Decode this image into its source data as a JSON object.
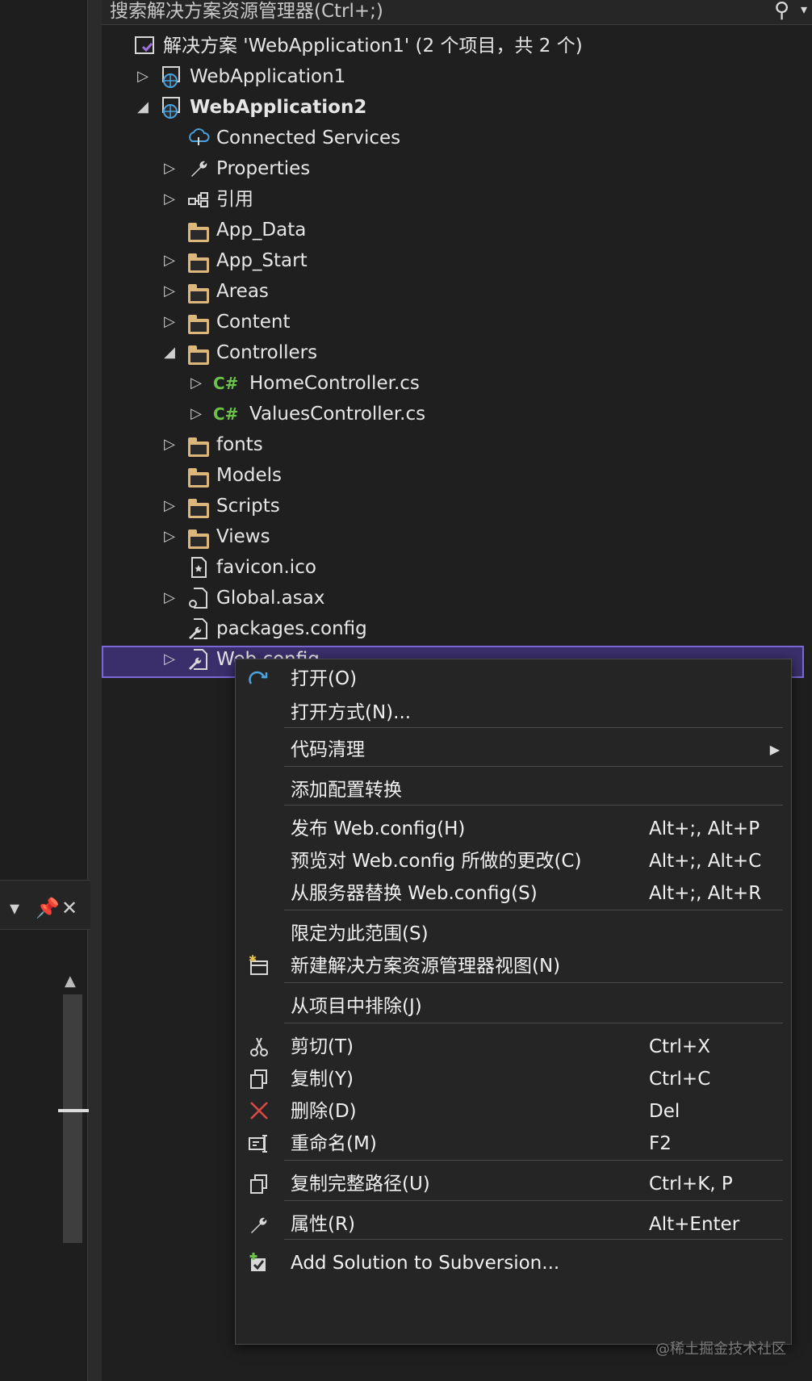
{
  "search": {
    "placeholder": "搜索解决方案资源管理器(Ctrl+;)"
  },
  "tree": [
    {
      "label": "解决方案 'WebApplication1' (2 个项目，共 2 个)",
      "icon": "solution-icon",
      "arrow": ""
    },
    {
      "label": "WebApplication1",
      "icon": "web-project-icon",
      "arrow": "▷"
    },
    {
      "label": "WebApplication2",
      "icon": "web-project-icon",
      "arrow": "◢"
    },
    {
      "label": "Connected Services",
      "icon": "cloud-plug-icon",
      "arrow": ""
    },
    {
      "label": "Properties",
      "icon": "wrench-icon",
      "arrow": "▷"
    },
    {
      "label": "引用",
      "icon": "references-icon",
      "arrow": "▷"
    },
    {
      "label": "App_Data",
      "icon": "folder-icon",
      "arrow": ""
    },
    {
      "label": "App_Start",
      "icon": "folder-icon",
      "arrow": "▷"
    },
    {
      "label": "Areas",
      "icon": "folder-icon",
      "arrow": "▷"
    },
    {
      "label": "Content",
      "icon": "folder-icon",
      "arrow": "▷"
    },
    {
      "label": "Controllers",
      "icon": "folder-icon",
      "arrow": "◢"
    },
    {
      "label": "HomeController.cs",
      "icon": "csharp-file-icon",
      "arrow": "▷"
    },
    {
      "label": "ValuesController.cs",
      "icon": "csharp-file-icon",
      "arrow": "▷"
    },
    {
      "label": "fonts",
      "icon": "folder-icon",
      "arrow": "▷"
    },
    {
      "label": "Models",
      "icon": "folder-icon",
      "arrow": ""
    },
    {
      "label": "Scripts",
      "icon": "folder-icon",
      "arrow": "▷"
    },
    {
      "label": "Views",
      "icon": "folder-icon",
      "arrow": "▷"
    },
    {
      "label": "favicon.ico",
      "icon": "image-file-icon",
      "arrow": ""
    },
    {
      "label": "Global.asax",
      "icon": "gear-file-icon",
      "arrow": "▷"
    },
    {
      "label": "packages.config",
      "icon": "config-file-icon",
      "arrow": ""
    },
    {
      "label": "Web.config",
      "icon": "config-file-icon",
      "arrow": "▷"
    }
  ],
  "context_menu": {
    "items": [
      {
        "label": "打开(O)",
        "shortcut": "",
        "icon": "redo-arrow-icon"
      },
      {
        "label": "打开方式(N)...",
        "shortcut": "",
        "icon": ""
      },
      {
        "label": "代码清理",
        "shortcut": "",
        "icon": ""
      },
      {
        "label": "添加配置转换",
        "shortcut": "",
        "icon": ""
      },
      {
        "label": "发布 Web.config(H)",
        "shortcut": "Alt+;, Alt+P",
        "icon": ""
      },
      {
        "label": "预览对 Web.config 所做的更改(C)",
        "shortcut": "Alt+;, Alt+C",
        "icon": ""
      },
      {
        "label": "从服务器替换 Web.config(S)",
        "shortcut": "Alt+;, Alt+R",
        "icon": ""
      },
      {
        "label": "限定为此范围(S)",
        "shortcut": "",
        "icon": ""
      },
      {
        "label": "新建解决方案资源管理器视图(N)",
        "shortcut": "",
        "icon": "new-window-icon"
      },
      {
        "label": "从项目中排除(J)",
        "shortcut": "",
        "icon": ""
      },
      {
        "label": "剪切(T)",
        "shortcut": "Ctrl+X",
        "icon": "scissors-icon"
      },
      {
        "label": "复制(Y)",
        "shortcut": "Ctrl+C",
        "icon": "copy-icon"
      },
      {
        "label": "删除(D)",
        "shortcut": "Del",
        "icon": "delete-x-icon"
      },
      {
        "label": "重命名(M)",
        "shortcut": "F2",
        "icon": "rename-icon"
      },
      {
        "label": "复制完整路径(U)",
        "shortcut": "Ctrl+K, P",
        "icon": "copy-icon"
      },
      {
        "label": "属性(R)",
        "shortcut": "Alt+Enter",
        "icon": "wrench-icon"
      },
      {
        "label": "Add Solution to Subversion...",
        "shortcut": "",
        "icon": "subversion-add-icon"
      }
    ]
  },
  "watermark": "@稀土掘金技术社区",
  "colors": {
    "selection": "#3a2f6b",
    "folder": "#dcb67a",
    "csharp": "#6cc24a",
    "delete": "#e04848",
    "accent": "#7a67d6"
  }
}
